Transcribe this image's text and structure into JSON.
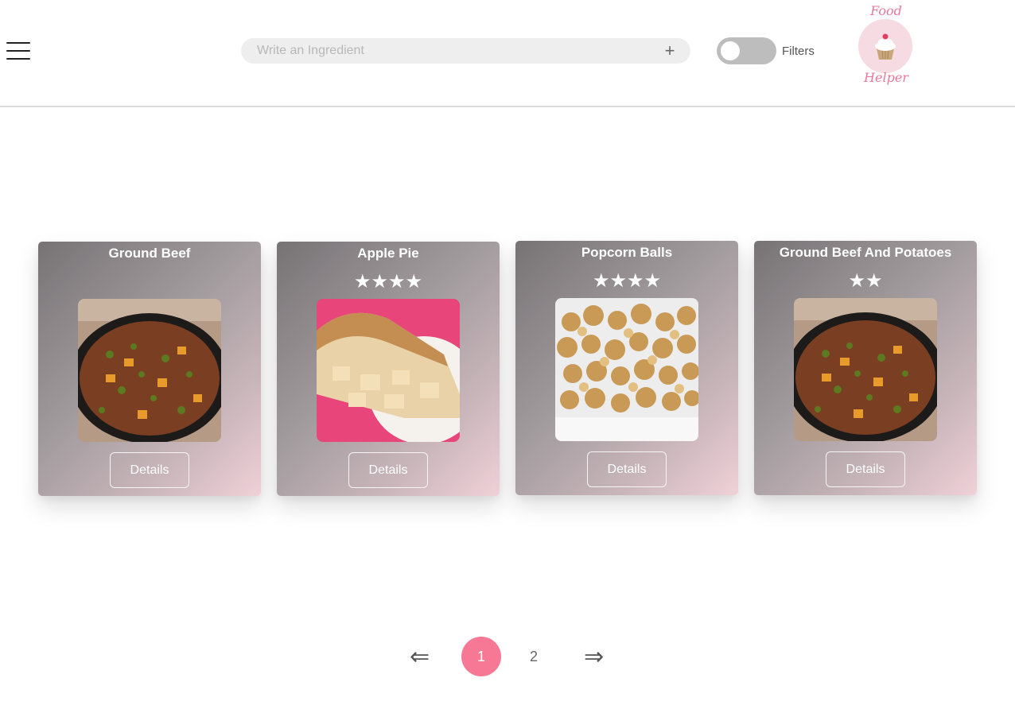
{
  "header": {
    "search_placeholder": "Write an Ingredient",
    "add_label": "+",
    "filters_label": "Filters",
    "filters_enabled": false,
    "logo_top": "Food",
    "logo_bottom": "Helper"
  },
  "recipes": [
    {
      "title": "Ground Beef",
      "stars": "",
      "rating": 0,
      "image": "ground-beef-skillet",
      "details_label": "Details"
    },
    {
      "title": "Apple Pie",
      "stars": "★★★★",
      "rating": 4,
      "image": "apple-pie-slice",
      "details_label": "Details"
    },
    {
      "title": "Popcorn Balls",
      "stars": "★★★★",
      "rating": 4,
      "image": "caramel-popcorn-bowl",
      "details_label": "Details"
    },
    {
      "title": "Ground Beef And Potatoes",
      "stars": "★★",
      "rating": 2,
      "image": "ground-beef-skillet",
      "details_label": "Details"
    }
  ],
  "pagination": {
    "prev_label": "⇐",
    "next_label": "⇒",
    "pages": [
      "1",
      "2"
    ],
    "current_page": "1"
  },
  "colors": {
    "accent": "#f77895",
    "logo_pink": "#e8789a",
    "toggle_off": "#bdbdbd",
    "search_bg": "#eeeeee"
  }
}
